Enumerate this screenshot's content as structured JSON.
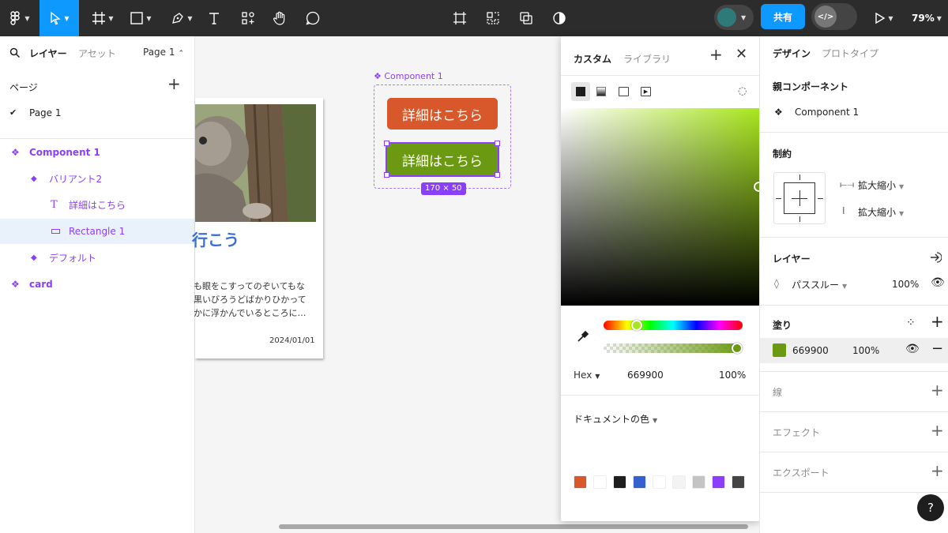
{
  "toolbar": {
    "share_label": "共有",
    "zoom": "79%",
    "dev_mode_label": "</>"
  },
  "layers_panel": {
    "tab_layers": "レイヤー",
    "tab_assets": "アセット",
    "page_selector": "Page 1",
    "pages_heading": "ページ",
    "current_page": "Page 1",
    "items": [
      {
        "label": "Component 1"
      },
      {
        "label": "バリアント2"
      },
      {
        "label": "詳細はこちら"
      },
      {
        "label": "Rectangle 1"
      },
      {
        "label": "デフォルト"
      },
      {
        "label": "card"
      }
    ]
  },
  "canvas": {
    "component_label": "Component 1",
    "button_default": "詳細はこちら",
    "button_variant": "詳細はこちら",
    "size_badge": "170 × 50",
    "card": {
      "title_fragment": "行こう",
      "body": [
        "も眼をこすってのぞいてもな",
        "黒いびろうどばかりひかって",
        "かに浮かんでいるところに…"
      ],
      "date": "2024/01/01"
    }
  },
  "color_picker": {
    "tab_custom": "カスタム",
    "tab_library": "ライブラリ",
    "format": "Hex",
    "hex_value": "669900",
    "opacity": "100%",
    "doc_colors_label": "ドキュメントの色",
    "doc_colors": [
      "#d9582b",
      "#ffffff",
      "#1e1e1e",
      "#3560d0",
      "#ffffff",
      "#f3f3f3",
      "#c4c4c4",
      "#8a3ffc",
      "#444444"
    ],
    "accent": "#a8e61e"
  },
  "design_panel": {
    "tab_design": "デザイン",
    "tab_prototype": "プロトタイプ",
    "parent_component_heading": "親コンポーネント",
    "parent_component": "Component 1",
    "constraints_heading": "制約",
    "constraint_h": "拡大縮小",
    "constraint_v": "拡大縮小",
    "layer_heading": "レイヤー",
    "blend_mode": "パススルー",
    "layer_opacity": "100%",
    "fill_heading": "塗り",
    "fill_hex": "669900",
    "fill_opacity": "100%",
    "fill_color": "#6b9a12",
    "stroke_heading": "線",
    "effects_heading": "エフェクト",
    "export_heading": "エクスポート"
  },
  "help_label": "?"
}
